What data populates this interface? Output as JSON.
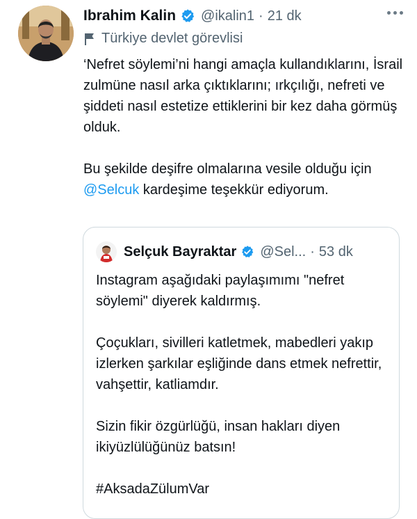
{
  "tweet": {
    "author_name": "Ibrahim Kalin",
    "handle": "@ikalin1",
    "separator": "·",
    "time": "21 dk",
    "label": "Türkiye devlet görevlisi",
    "text_part1": "‘Nefret söylemi’ni hangi amaçla kullandıklarını, İsrail zulmüne nasıl arka çıktıklarını; ırkçılığı, nefreti ve şiddeti nasıl estetize ettiklerini bir kez daha görmüş olduk.\n\nBu şekilde deşifre olmalarına vesile olduğu için ",
    "mention": "@Selcuk",
    "text_part2": " kardeşime teşekkür ediyorum.",
    "verified_icon": "verified-badge-icon",
    "label_icon": "flag-icon",
    "accent_color": "#1d9bf0"
  },
  "quote": {
    "author_name": "Selçuk Bayraktar",
    "handle": "@Sel...",
    "separator": "·",
    "time": "53 dk",
    "text": "Instagram aşağıdaki paylaşımımı \"nefret söylemi\" diyerek kaldırmış.\n\nÇoçukları, sivilleri katletmek, mabedleri yakıp izlerken şarkılar eşliğinde dans etmek nefrettir, vahşettir, katliamdır.\n\nSizin fikir özgürlüğü, insan hakları diyen ikiyüzlülüğünüz batsın!\n\n#AksadaZülumVar"
  }
}
